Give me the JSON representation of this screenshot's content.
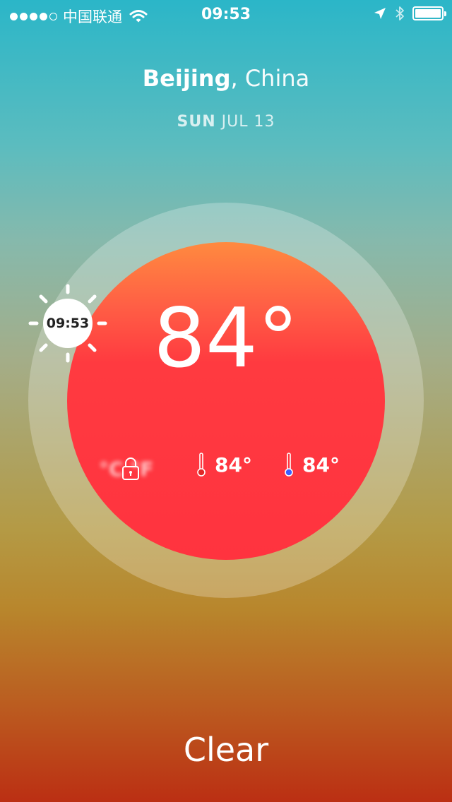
{
  "status_bar": {
    "carrier": "中国联通",
    "time": "09:53",
    "signal_bars": 5,
    "signal_filled": 4,
    "battery_level": 1.0
  },
  "location": {
    "city": "Beijing",
    "separator": ",",
    "country": "China"
  },
  "date": {
    "weekday": "SUN",
    "day": "JUL 13"
  },
  "weather": {
    "current_temp": "84°",
    "high_temp": "84°",
    "low_temp": "84°",
    "condition": "Clear"
  },
  "sun_marker": {
    "time": "09:53"
  },
  "colors": {
    "dial_red": "#ff333f",
    "dial_orange": "#ff8a3f",
    "sky_top": "#2bb6c8",
    "ground_bottom": "#bb2f13",
    "high_thermo": "#e02828",
    "low_thermo": "#3a5dff"
  }
}
